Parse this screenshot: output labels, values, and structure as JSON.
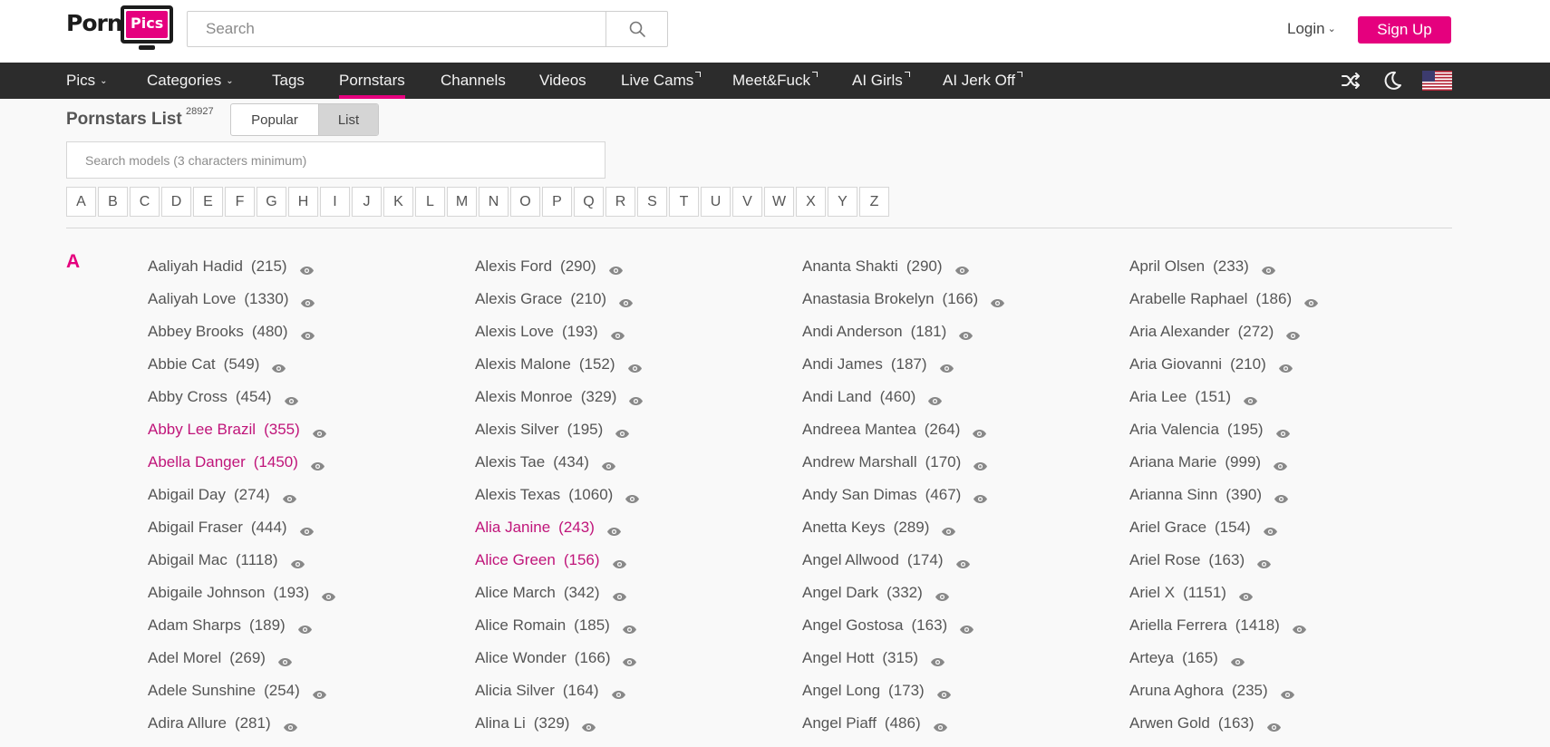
{
  "header": {
    "logo": {
      "porn": "Porn",
      "pics": "Pics"
    },
    "search_placeholder": "Search",
    "login_label": "Login",
    "signup_label": "Sign Up"
  },
  "nav": {
    "items": [
      {
        "label": "Pics"
      },
      {
        "label": "Categories"
      },
      {
        "label": "Tags"
      },
      {
        "label": "Pornstars"
      },
      {
        "label": "Channels"
      },
      {
        "label": "Videos"
      },
      {
        "label": "Live Cams"
      },
      {
        "label": "Meet&Fuck"
      },
      {
        "label": "AI Girls"
      },
      {
        "label": "AI Jerk Off"
      }
    ],
    "active": "Pornstars"
  },
  "page": {
    "title": "Pornstars List",
    "count": "28927",
    "toggle": {
      "popular": "Popular",
      "list": "List",
      "selected": "List"
    },
    "model_search_placeholder": "Search models (3 characters minimum)",
    "letters": [
      "A",
      "B",
      "C",
      "D",
      "E",
      "F",
      "G",
      "H",
      "I",
      "J",
      "K",
      "L",
      "M",
      "N",
      "O",
      "P",
      "Q",
      "R",
      "S",
      "T",
      "U",
      "V",
      "W",
      "X",
      "Y",
      "Z"
    ],
    "section_letter": "A"
  },
  "columns": [
    [
      {
        "name": "Aaliyah Hadid",
        "count": "(215)"
      },
      {
        "name": "Aaliyah Love",
        "count": "(1330)"
      },
      {
        "name": "Abbey Brooks",
        "count": "(480)"
      },
      {
        "name": "Abbie Cat",
        "count": "(549)"
      },
      {
        "name": "Abby Cross",
        "count": "(454)"
      },
      {
        "name": "Abby Lee Brazil",
        "count": "(355)",
        "highlight": true
      },
      {
        "name": "Abella Danger",
        "count": "(1450)",
        "highlight": true
      },
      {
        "name": "Abigail Day",
        "count": "(274)"
      },
      {
        "name": "Abigail Fraser",
        "count": "(444)"
      },
      {
        "name": "Abigail Mac",
        "count": "(1118)"
      },
      {
        "name": "Abigaile Johnson",
        "count": "(193)"
      },
      {
        "name": "Adam Sharps",
        "count": "(189)"
      },
      {
        "name": "Adel Morel",
        "count": "(269)"
      },
      {
        "name": "Adele Sunshine",
        "count": "(254)"
      },
      {
        "name": "Adira Allure",
        "count": "(281)"
      }
    ],
    [
      {
        "name": "Alexis Ford",
        "count": "(290)"
      },
      {
        "name": "Alexis Grace",
        "count": "(210)"
      },
      {
        "name": "Alexis Love",
        "count": "(193)"
      },
      {
        "name": "Alexis Malone",
        "count": "(152)"
      },
      {
        "name": "Alexis Monroe",
        "count": "(329)"
      },
      {
        "name": "Alexis Silver",
        "count": "(195)"
      },
      {
        "name": "Alexis Tae",
        "count": "(434)"
      },
      {
        "name": "Alexis Texas",
        "count": "(1060)"
      },
      {
        "name": "Alia Janine",
        "count": "(243)",
        "highlight": true
      },
      {
        "name": "Alice Green",
        "count": "(156)",
        "highlight": true
      },
      {
        "name": "Alice March",
        "count": "(342)"
      },
      {
        "name": "Alice Romain",
        "count": "(185)"
      },
      {
        "name": "Alice Wonder",
        "count": "(166)"
      },
      {
        "name": "Alicia Silver",
        "count": "(164)"
      },
      {
        "name": "Alina Li",
        "count": "(329)"
      }
    ],
    [
      {
        "name": "Ananta Shakti",
        "count": "(290)"
      },
      {
        "name": "Anastasia Brokelyn",
        "count": "(166)"
      },
      {
        "name": "Andi Anderson",
        "count": "(181)"
      },
      {
        "name": "Andi James",
        "count": "(187)"
      },
      {
        "name": "Andi Land",
        "count": "(460)"
      },
      {
        "name": "Andreea Mantea",
        "count": "(264)"
      },
      {
        "name": "Andrew Marshall",
        "count": "(170)"
      },
      {
        "name": "Andy San Dimas",
        "count": "(467)"
      },
      {
        "name": "Anetta Keys",
        "count": "(289)"
      },
      {
        "name": "Angel Allwood",
        "count": "(174)"
      },
      {
        "name": "Angel Dark",
        "count": "(332)"
      },
      {
        "name": "Angel Gostosa",
        "count": "(163)"
      },
      {
        "name": "Angel Hott",
        "count": "(315)"
      },
      {
        "name": "Angel Long",
        "count": "(173)"
      },
      {
        "name": "Angel Piaff",
        "count": "(486)"
      }
    ],
    [
      {
        "name": "April Olsen",
        "count": "(233)"
      },
      {
        "name": "Arabelle Raphael",
        "count": "(186)"
      },
      {
        "name": "Aria Alexander",
        "count": "(272)"
      },
      {
        "name": "Aria Giovanni",
        "count": "(210)"
      },
      {
        "name": "Aria Lee",
        "count": "(151)"
      },
      {
        "name": "Aria Valencia",
        "count": "(195)"
      },
      {
        "name": "Ariana Marie",
        "count": "(999)"
      },
      {
        "name": "Arianna Sinn",
        "count": "(390)"
      },
      {
        "name": "Ariel Grace",
        "count": "(154)"
      },
      {
        "name": "Ariel Rose",
        "count": "(163)"
      },
      {
        "name": "Ariel X",
        "count": "(1151)"
      },
      {
        "name": "Ariella Ferrera",
        "count": "(1418)"
      },
      {
        "name": "Arteya",
        "count": "(165)"
      },
      {
        "name": "Aruna Aghora",
        "count": "(235)"
      },
      {
        "name": "Arwen Gold",
        "count": "(163)"
      }
    ]
  ],
  "colors": {
    "accent": "#e5007e",
    "navbar": "#2c2c2c",
    "highlight_link": "#c0157a"
  },
  "icons": [
    "search-icon",
    "shuffle-icon",
    "moon-icon",
    "us-flag-icon",
    "eye-icon",
    "chevron-down-icon",
    "external-link-icon"
  ]
}
